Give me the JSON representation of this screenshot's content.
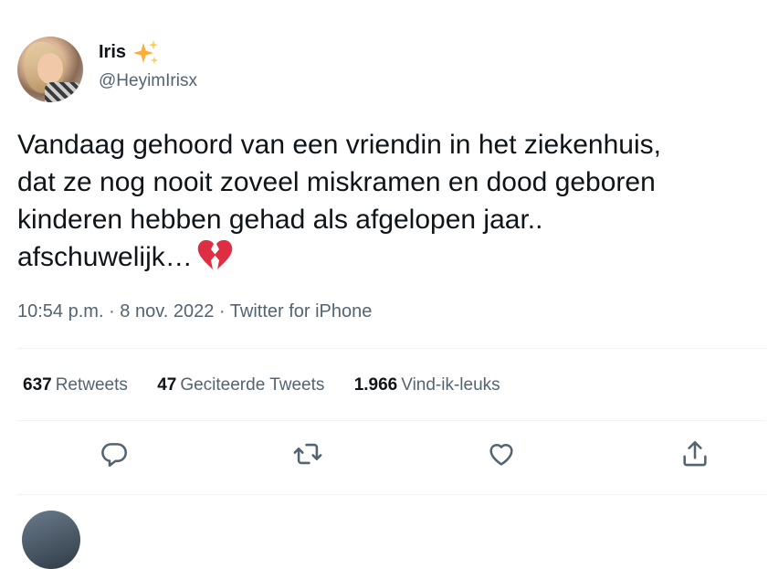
{
  "user": {
    "display_name": "Iris",
    "handle": "@HeyimIrisx"
  },
  "tweet": {
    "lines": [
      "Vandaag gehoord van een vriendin in het ziekenhuis,",
      "dat ze nog nooit zoveel miskramen en dood geboren",
      "kinderen hebben gehad als afgelopen jaar..",
      "afschuwelijk…"
    ],
    "time": "10:54 p.m.",
    "separator": " · ",
    "date": "8 nov. 2022",
    "source": "Twitter for iPhone"
  },
  "stats": [
    {
      "count": "637",
      "label": "Retweets"
    },
    {
      "count": "47",
      "label": "Geciteerde Tweets"
    },
    {
      "count": "1.966",
      "label": "Vind-ik-leuks"
    }
  ],
  "icons": {
    "name_emoji": "sparkles-icon",
    "text_emoji": "broken-heart-icon",
    "actions": [
      "reply-icon",
      "retweet-icon",
      "like-icon",
      "share-icon"
    ]
  },
  "colors": {
    "text_primary": "#0f1419",
    "text_secondary": "#536471",
    "divider": "#eff3f4",
    "broken_heart": "#dd2e44",
    "sparkle": "#ffac33"
  }
}
